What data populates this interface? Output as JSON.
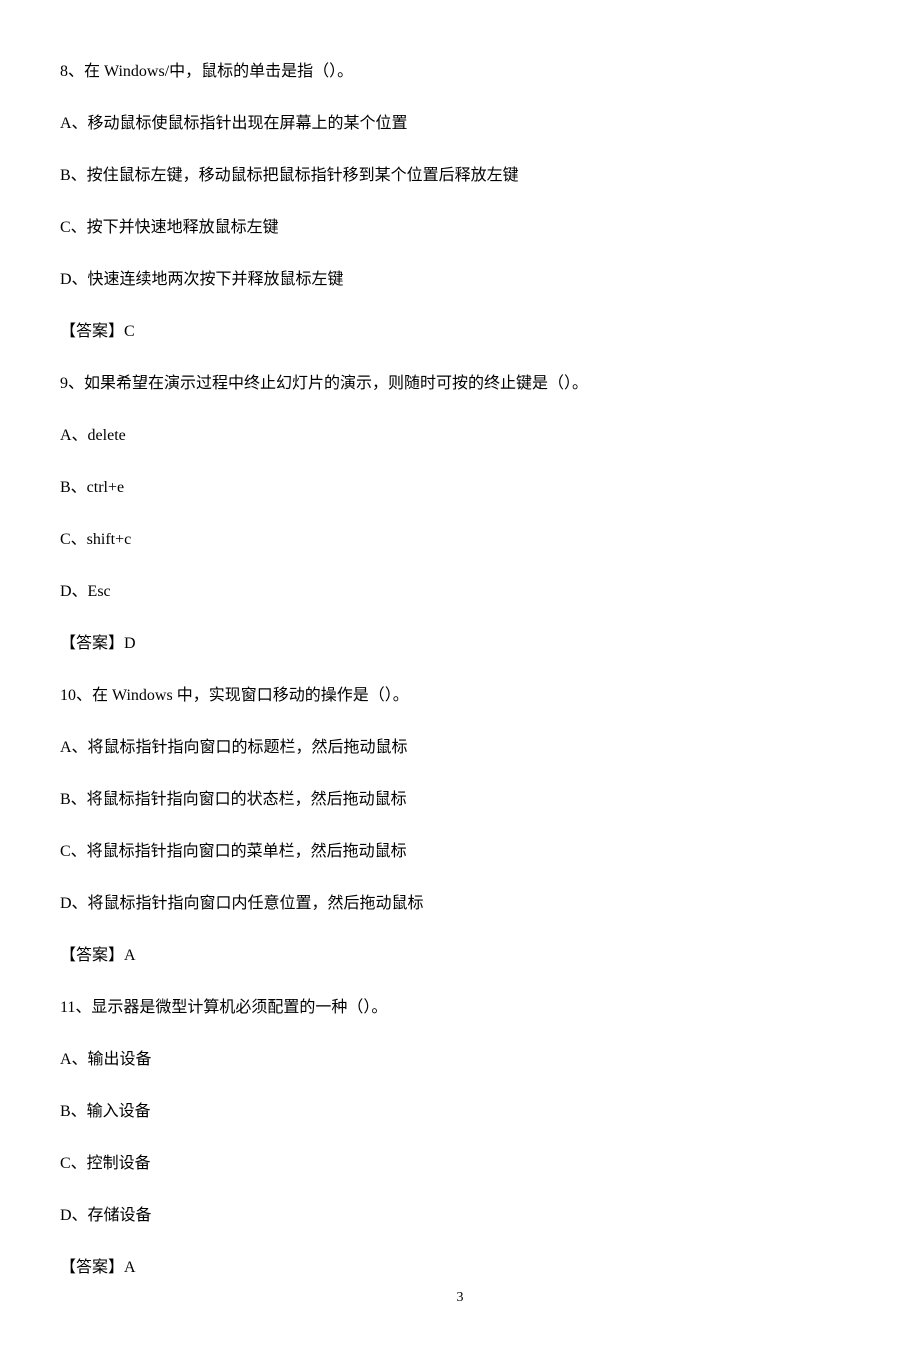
{
  "q8": {
    "stem": "8、在 Windows/中，鼠标的单击是指（）。",
    "A": "A、移动鼠标使鼠标指针出现在屏幕上的某个位置",
    "B": "B、按住鼠标左键，移动鼠标把鼠标指针移到某个位置后释放左键",
    "C": "C、按下并快速地释放鼠标左键",
    "D": "D、快速连续地两次按下并释放鼠标左键",
    "answer": "【答案】C"
  },
  "q9": {
    "stem": "9、如果希望在演示过程中终止幻灯片的演示，则随时可按的终止键是（）。",
    "A": "A、delete",
    "B": "B、ctrl+e",
    "C": "C、shift+c",
    "D": "D、Esc",
    "answer": "【答案】D"
  },
  "q10": {
    "stem": "10、在 Windows 中，实现窗口移动的操作是（）。",
    "A": "A、将鼠标指针指向窗口的标题栏，然后拖动鼠标",
    "B": "B、将鼠标指针指向窗口的状态栏，然后拖动鼠标",
    "C": "C、将鼠标指针指向窗口的菜单栏，然后拖动鼠标",
    "D": "D、将鼠标指针指向窗口内任意位置，然后拖动鼠标",
    "answer": "【答案】A"
  },
  "q11": {
    "stem": "11、显示器是微型计算机必须配置的一种（）。",
    "A": "A、输出设备",
    "B": "B、输入设备",
    "C": "C、控制设备",
    "D": "D、存储设备",
    "answer": "【答案】A"
  },
  "page_number": "3"
}
